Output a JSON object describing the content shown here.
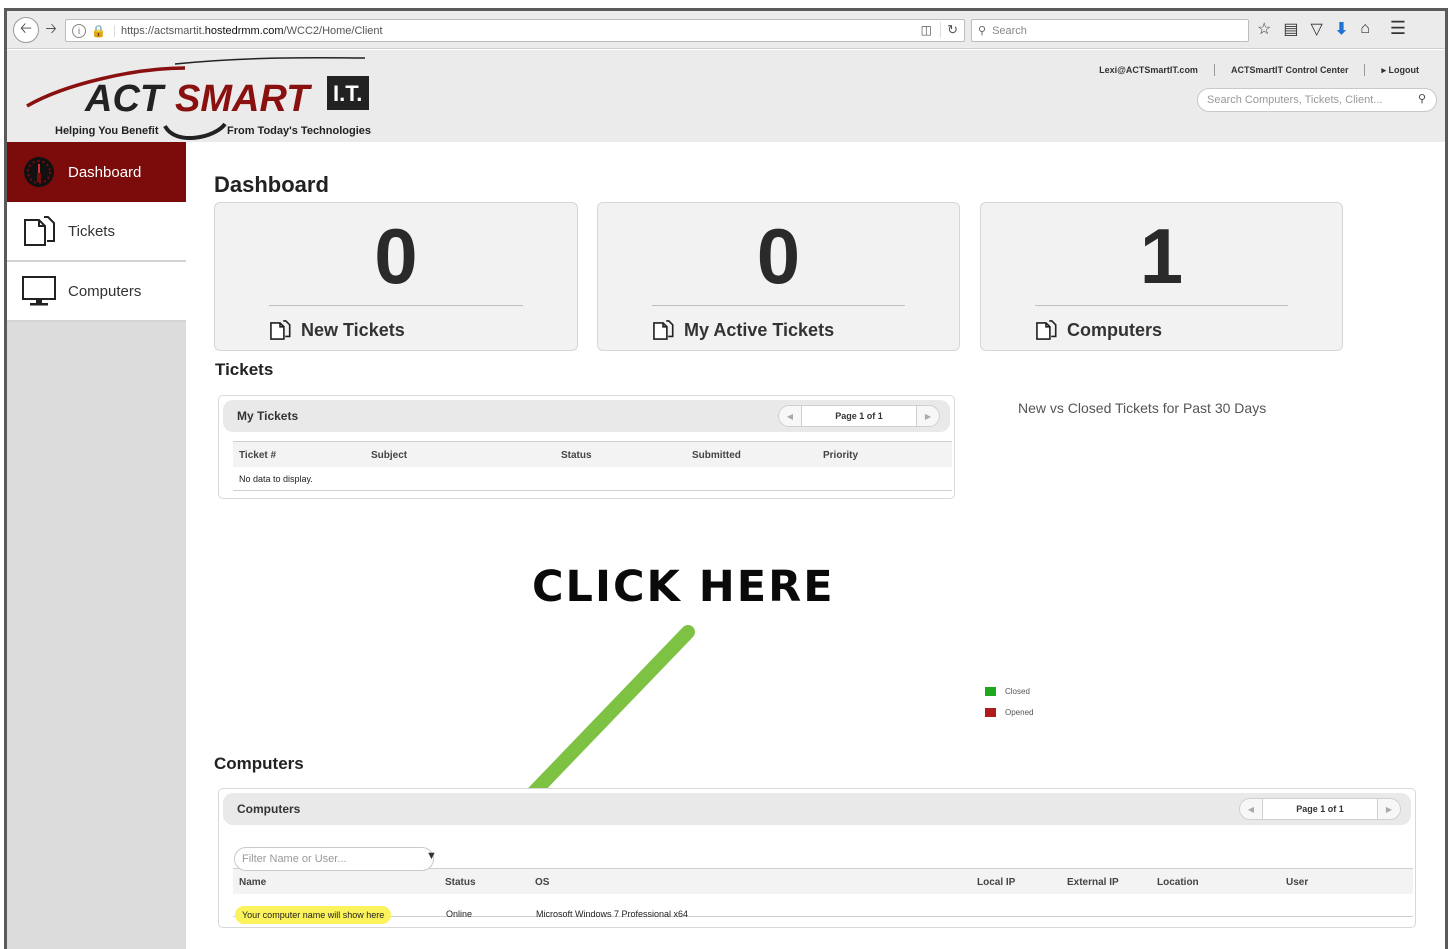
{
  "browser": {
    "url_prefix": "https://actsmartit.",
    "url_host": "hostedrmm.com",
    "url_path": "/WCC2/Home/Client",
    "search_placeholder": "Search"
  },
  "header": {
    "brand_act": "ACT",
    "brand_smart": "SMART",
    "brand_it": "I.T.",
    "tagline_left": "Helping You Benefit",
    "tagline_right": "From Today's Technologies",
    "user_email": "Lexi@ACTSmartIT.com",
    "control_center": "ACTSmartIT Control Center",
    "logout": "Logout",
    "search_placeholder": "Search Computers, Tickets, Client..."
  },
  "sidebar": {
    "items": [
      {
        "label": "Dashboard",
        "icon": "gauge-icon",
        "active": true
      },
      {
        "label": "Tickets",
        "icon": "tickets-icon",
        "active": false
      },
      {
        "label": "Computers",
        "icon": "monitor-icon",
        "active": false
      }
    ]
  },
  "main": {
    "title": "Dashboard",
    "cards": [
      {
        "value": "0",
        "label": "New Tickets",
        "icon": "tickets-icon"
      },
      {
        "value": "0",
        "label": "My Active Tickets",
        "icon": "tickets-icon"
      },
      {
        "value": "1",
        "label": "Computers",
        "icon": "tickets-icon"
      }
    ],
    "tickets_section": "Tickets",
    "tickets_grid": {
      "title": "My Tickets",
      "pager": "Page 1 of 1",
      "columns": [
        "Ticket #",
        "Subject",
        "Status",
        "Submitted",
        "Priority"
      ],
      "empty_text": "No data to display."
    },
    "chart": {
      "title": "New vs Closed Tickets for Past 30 Days",
      "legend": [
        {
          "label": "Closed",
          "color": "#1fa81f"
        },
        {
          "label": "Opened",
          "color": "#b01c1c"
        }
      ]
    },
    "callout": "CLICK HERE",
    "computers_section": "Computers",
    "computers_grid": {
      "title": "Computers",
      "pager": "Page 1 of 1",
      "filter_placeholder": "Filter Name or User...",
      "columns": [
        "Name",
        "Status",
        "OS",
        "Local IP",
        "External IP",
        "Location",
        "User"
      ],
      "rows": [
        {
          "name": "Your computer name will show here",
          "status": "Online",
          "os": "Microsoft Windows 7 Professional x64",
          "local_ip": "",
          "external_ip": "",
          "location": "",
          "user": ""
        }
      ]
    }
  },
  "colors": {
    "accent": "#7c0b0b",
    "arrow": "#7dc242",
    "highlight": "#fbf25c"
  }
}
